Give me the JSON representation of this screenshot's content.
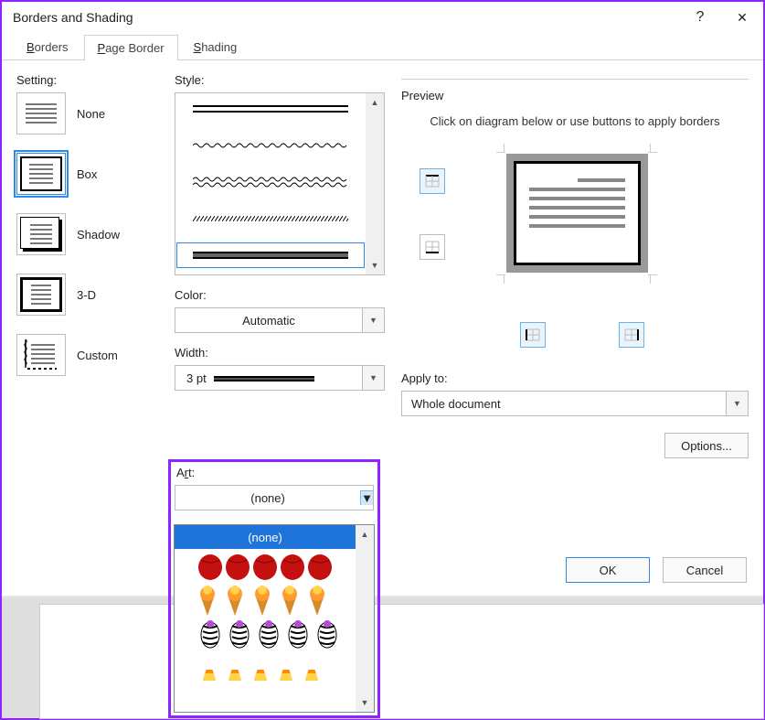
{
  "dialog": {
    "title": "Borders and Shading",
    "help_icon": "?",
    "close_icon": "✕"
  },
  "tabs": [
    {
      "label": "Borders",
      "underline_char": "B"
    },
    {
      "label": "Page Border",
      "underline_char": "P"
    },
    {
      "label": "Shading",
      "underline_char": "S"
    }
  ],
  "active_tab": 1,
  "setting": {
    "label": "Setting:",
    "items": [
      {
        "name": "none",
        "label": "None",
        "underline": "N",
        "selected": false
      },
      {
        "name": "box",
        "label": "Box",
        "underline": "x",
        "selected": true
      },
      {
        "name": "shadow",
        "label": "Shadow",
        "underline": "d",
        "selected": false
      },
      {
        "name": "3d",
        "label": "3-D",
        "underline": "D",
        "selected": false
      },
      {
        "name": "custom",
        "label": "Custom",
        "underline": "U",
        "selected": false
      }
    ]
  },
  "style": {
    "label": "Style:",
    "selected_index": 4
  },
  "color": {
    "label": "Color:",
    "underline": "C",
    "value": "Automatic"
  },
  "width": {
    "label": "Width:",
    "underline": "W",
    "value": "3 pt"
  },
  "art": {
    "label": "Art:",
    "underline": "r",
    "value": "(none)",
    "options": [
      {
        "type": "text",
        "value": "(none)",
        "selected": true
      },
      {
        "type": "art",
        "name": "apples-red"
      },
      {
        "type": "art",
        "name": "ice-cream-cones"
      },
      {
        "type": "art",
        "name": "zebra-stripes"
      },
      {
        "type": "art",
        "name": "candy-corn"
      }
    ]
  },
  "preview": {
    "label": "Preview",
    "helper": "Click on diagram below or use buttons to apply borders"
  },
  "apply": {
    "label": "Apply to:",
    "value": "Whole document"
  },
  "options_label": "Options...",
  "ok_label": "OK",
  "cancel_label": "Cancel"
}
